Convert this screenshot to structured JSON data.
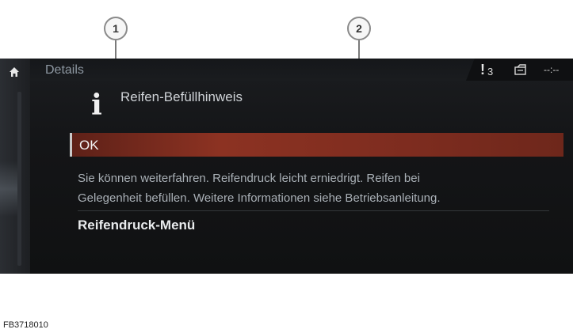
{
  "callouts": [
    "1",
    "2"
  ],
  "screen": {
    "title": "Details",
    "status": {
      "warning_symbol": "!",
      "warning_count": "3",
      "icon": "vehicle-status-icon",
      "time": "--:--"
    },
    "header": {
      "icon": "info-icon",
      "icon_glyph": "i",
      "text": "Reifen-Befüllhinweis"
    },
    "ok_button": "OK",
    "message_line1": "Sie können weiterfahren. Reifendruck leicht erniedrigt. Reifen bei",
    "message_line2": "Gelegenheit befüllen. Weitere Informationen siehe Betriebsanleitung.",
    "menu_item": "Reifendruck-Menü"
  },
  "figure_id": "FB3718010",
  "colors": {
    "highlight": "#8c3222",
    "background": "#141517",
    "title": "#8e98a2"
  }
}
